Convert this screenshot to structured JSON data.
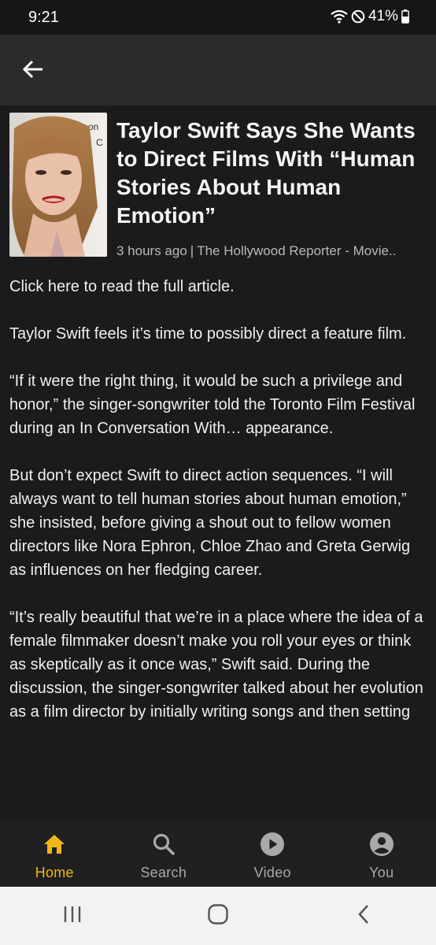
{
  "status_bar": {
    "time": "9:21",
    "battery": "41%"
  },
  "toolbar": {
    "back_icon": "arrow-left-icon"
  },
  "article": {
    "headline": "Taylor Swift Says She Wants to Direct Films With “Human Stories About Human Emotion”",
    "time_ago": "3 hours ago",
    "separator": "|",
    "source": "The Hollywood Reporter - Movie..",
    "read_link": "Click here to read the full article.",
    "paragraphs": [
      "Taylor Swift feels it’s time to possibly direct a feature film.",
      "“If it were the right thing, it would be such a privilege and honor,” the singer-songwriter told the Toronto Film Festival during an In Conversation With… appearance.",
      "But don’t expect Swift to direct action sequences. “I will always want to tell human stories about human emotion,” she insisted, before giving a shout out to fellow women directors like Nora Ephron, Chloe Zhao and Greta Gerwig as influences on her fledging career.",
      "“It’s really beautiful that we’re in a place where the idea of a female filmmaker doesn’t make you roll your eyes or think as skeptically as it once was,” Swift said. During the discussion, the singer-songwriter talked about her evolution as a film director by initially writing songs and then setting"
    ],
    "thumbnail_text": "on\nC"
  },
  "bottom_nav": {
    "items": [
      {
        "label": "Home",
        "icon": "home-icon",
        "active": true
      },
      {
        "label": "Search",
        "icon": "search-icon",
        "active": false
      },
      {
        "label": "Video",
        "icon": "play-circle-icon",
        "active": false
      },
      {
        "label": "You",
        "icon": "account-circle-icon",
        "active": false
      }
    ]
  },
  "colors": {
    "accent": "#f3b619",
    "background": "#1b1b1b",
    "toolbar": "#2b2b2b",
    "nav_bar": "#202020"
  }
}
